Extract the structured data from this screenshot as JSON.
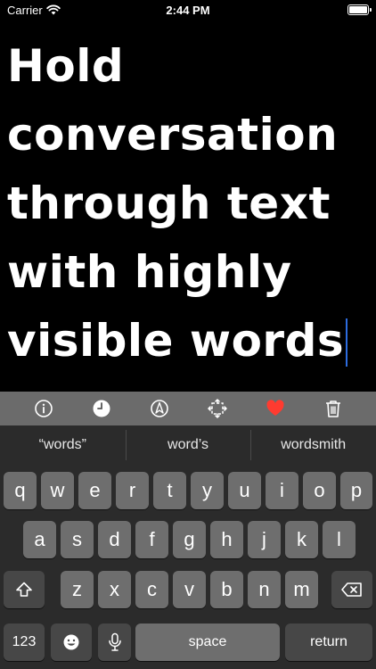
{
  "status_bar": {
    "carrier": "Carrier",
    "time": "2:44 PM",
    "battery_level": 1.0
  },
  "editor": {
    "text_lines": [
      "Hold",
      "conversation",
      "through text",
      "with highly",
      "visible words"
    ]
  },
  "toolbar": {
    "items": [
      {
        "name": "info-icon"
      },
      {
        "name": "clock-icon"
      },
      {
        "name": "compass-icon"
      },
      {
        "name": "rotate-screen-icon"
      },
      {
        "name": "heart-icon",
        "color": "#ff3b30"
      },
      {
        "name": "trash-icon"
      }
    ]
  },
  "keyboard": {
    "suggestions": [
      "“words”",
      "word’s",
      "wordsmith"
    ],
    "row1": [
      "q",
      "w",
      "e",
      "r",
      "t",
      "y",
      "u",
      "i",
      "o",
      "p"
    ],
    "row2": [
      "a",
      "s",
      "d",
      "f",
      "g",
      "h",
      "j",
      "k",
      "l"
    ],
    "row3": [
      "z",
      "x",
      "c",
      "v",
      "b",
      "n",
      "m"
    ],
    "numbers_key": "123",
    "space_key": "space",
    "return_key": "return"
  },
  "colors": {
    "toolbar_bg": "#6b6b6b",
    "keyboard_bg": "#2b2b2b",
    "key_bg": "#6e6e6e",
    "special_key_bg": "#474747",
    "caret": "#2d6cdf",
    "heart": "#ff3b30"
  }
}
